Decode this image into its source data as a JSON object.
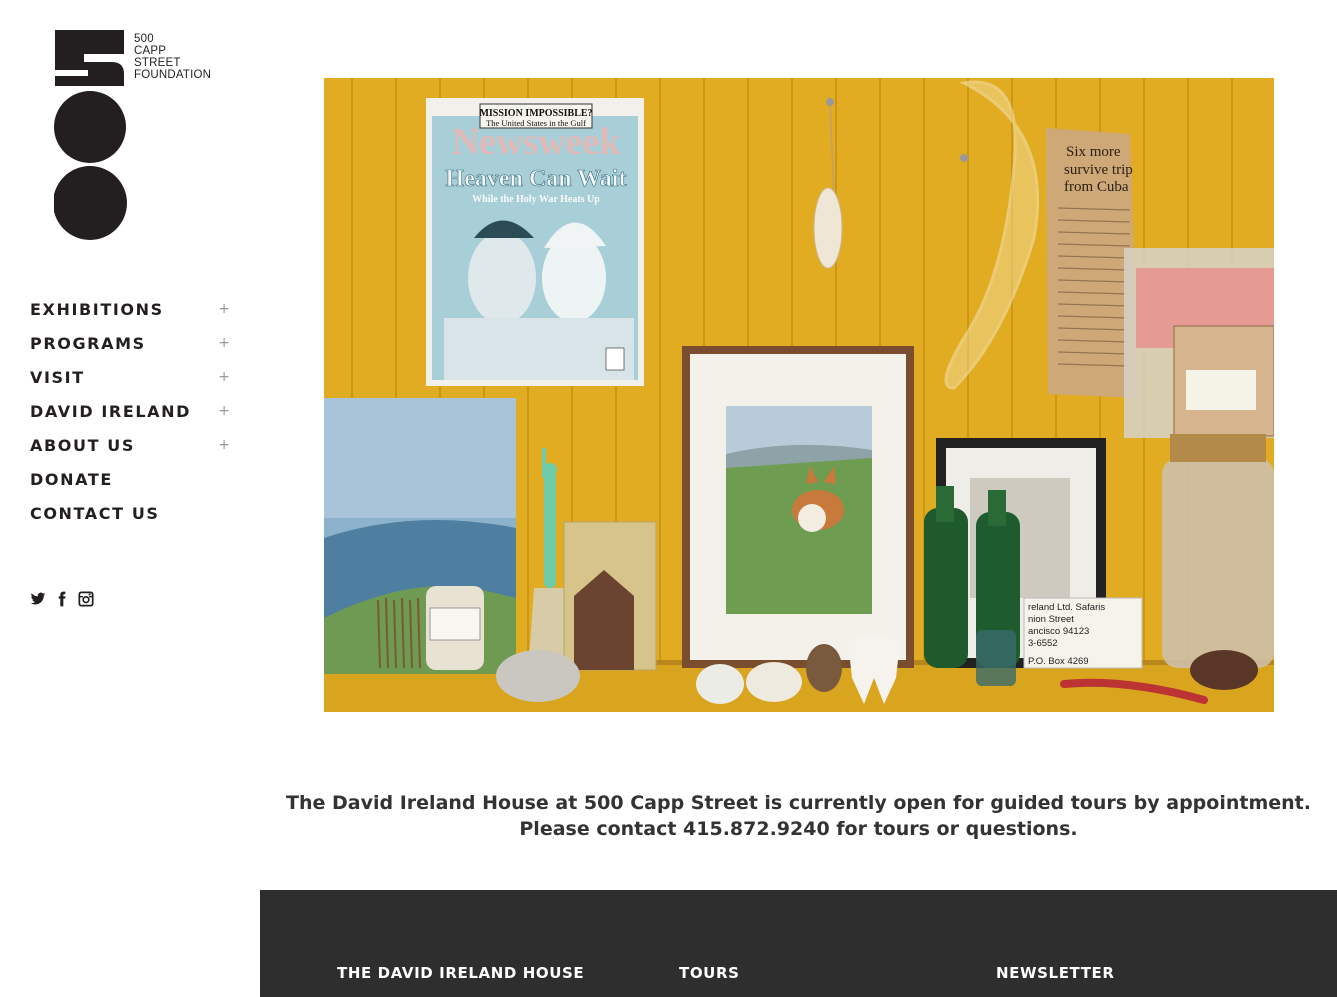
{
  "logo": {
    "lines": [
      "500",
      "CAPP",
      "STREET",
      "FOUNDATION"
    ]
  },
  "nav": {
    "items": [
      {
        "label": "EXHIBITIONS",
        "expandable": true,
        "toggle": "+"
      },
      {
        "label": "PROGRAMS",
        "expandable": true,
        "toggle": "+"
      },
      {
        "label": "VISIT",
        "expandable": true,
        "toggle": "+"
      },
      {
        "label": "DAVID IRELAND",
        "expandable": true,
        "toggle": "+"
      },
      {
        "label": "ABOUT US",
        "expandable": true,
        "toggle": "+"
      },
      {
        "label": "DONATE",
        "expandable": false
      },
      {
        "label": "CONTACT US",
        "expandable": false
      }
    ]
  },
  "social": {
    "icons": [
      "twitter-icon",
      "facebook-icon",
      "instagram-icon"
    ]
  },
  "hero": {
    "magazine": {
      "banner_line1": "MISSION IMPOSSIBLE?",
      "banner_line2": "The United States in the Gulf",
      "masthead": "Newsweek",
      "headline": "Heaven Can Wait",
      "subhead": "While the Holy War Heats Up"
    },
    "clipping": {
      "line1": "Six more",
      "line2": "survive trip",
      "line3": "from Cuba"
    },
    "postcard": {
      "line1": "reland Ltd. Safaris",
      "line2": "nion Street",
      "line3": "ancisco 94123",
      "line4": "3-6552",
      "line5": "P.O. Box 4269"
    }
  },
  "notice": {
    "line1": "The David Ireland House at 500 Capp Street is currently open for guided tours by appointment.",
    "line2": "Please contact 415.872.9240 for tours or questions."
  },
  "footer": {
    "col1_heading": "THE DAVID IRELAND HOUSE",
    "col2_heading": "TOURS",
    "col3_heading": "NEWSLETTER"
  },
  "colors": {
    "text": "#231f20",
    "footer_bg": "#2e2e2e",
    "notice_text": "#333333",
    "wall_yellow": "#e0a820"
  }
}
